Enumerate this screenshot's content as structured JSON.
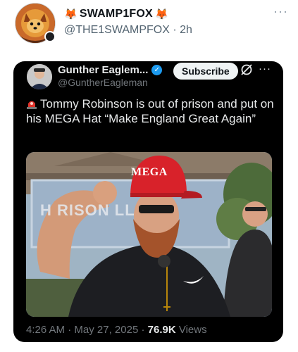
{
  "outer_post": {
    "display_name": "SWAMP1FOX",
    "name_prefix_emoji": "🦊",
    "name_suffix_emoji": "🦊",
    "handle": "@THE1SWAMPFOX",
    "separator": "·",
    "time_ago": "2h",
    "more_label": "···"
  },
  "embedded_post": {
    "display_name": "Gunther Eaglem...",
    "handle": "@GuntherEagleman",
    "subscribe_label": "Subscribe",
    "more_label": "···",
    "text": "Tommy Robinson is out of prison and put on his MEGA Hat “Make England Great Again”",
    "image": {
      "hat_text": "MEGA",
      "sign_text": "H  RISON   LL"
    },
    "time": "4:26 AM",
    "date": "May 27, 2025",
    "views_count": "76.9K",
    "views_label": "Views"
  },
  "colors": {
    "accent_blue": "#1d9bf0",
    "card_bg": "#000000",
    "muted_gray": "#71767b",
    "fox_orange": "#e8651e",
    "hat_red": "#d8222a"
  }
}
